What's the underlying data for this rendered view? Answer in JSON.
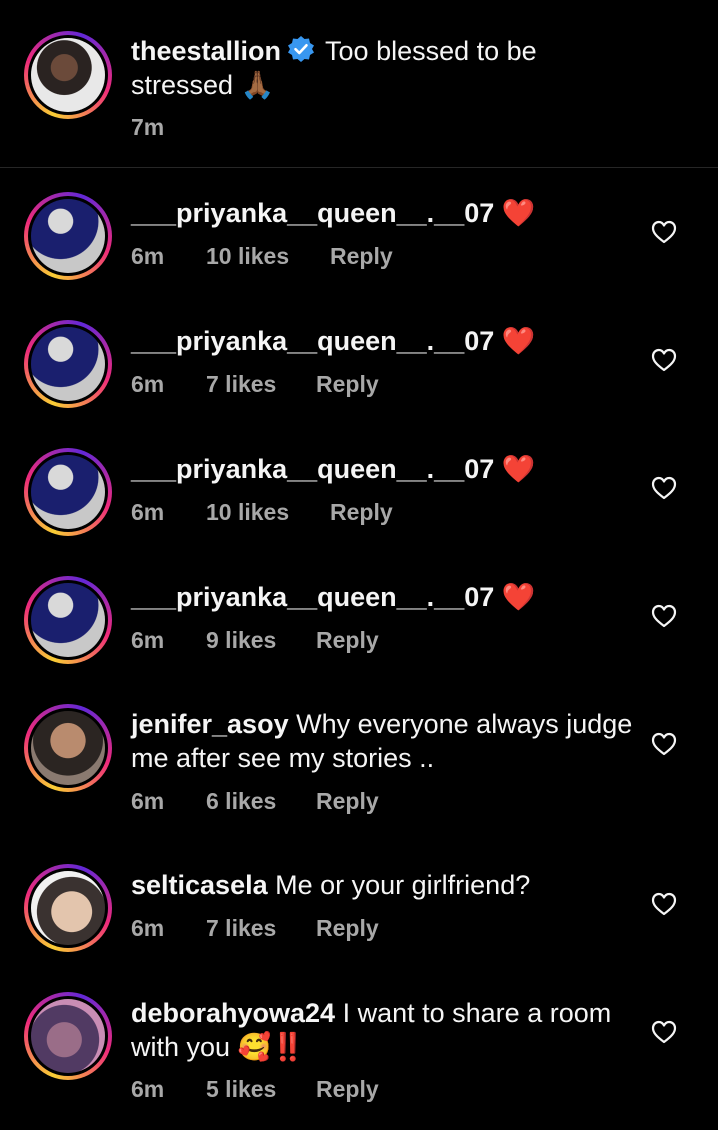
{
  "caption": {
    "username": "theestallion",
    "text": "Too blessed to be stressed",
    "emoji": "🙏🏾",
    "time": "7m"
  },
  "comments": [
    {
      "username": "___priyanka__queen__.__07",
      "text": "",
      "emoji": "❤️",
      "time": "6m",
      "likes": "10 likes",
      "reply": "Reply"
    },
    {
      "username": "___priyanka__queen__.__07",
      "text": "",
      "emoji": "❤️",
      "time": "6m",
      "likes": "7 likes",
      "reply": "Reply"
    },
    {
      "username": "___priyanka__queen__.__07",
      "text": "",
      "emoji": "❤️",
      "time": "6m",
      "likes": "10 likes",
      "reply": "Reply"
    },
    {
      "username": "___priyanka__queen__.__07",
      "text": "",
      "emoji": "❤️",
      "time": "6m",
      "likes": "9 likes",
      "reply": "Reply"
    },
    {
      "username": "jenifer_asoy",
      "text": "Why everyone always judge me after see my stories ..",
      "emoji": "",
      "time": "6m",
      "likes": "6 likes",
      "reply": "Reply"
    },
    {
      "username": "selticasela",
      "text": "Me or your girlfriend?",
      "emoji": "",
      "time": "6m",
      "likes": "7 likes",
      "reply": "Reply"
    },
    {
      "username": "deborahyowa24",
      "text": "I want to share a room with you",
      "emoji": "🥰‼️",
      "time": "6m",
      "likes": "5 likes",
      "reply": "Reply"
    }
  ],
  "colors": {
    "background": "#000000",
    "text": "#f5f5f5",
    "meta": "#a8a8a8",
    "verified": "#3897f0"
  },
  "icons": {
    "like": "heart-outline-icon",
    "verified": "verified-badge-icon"
  }
}
